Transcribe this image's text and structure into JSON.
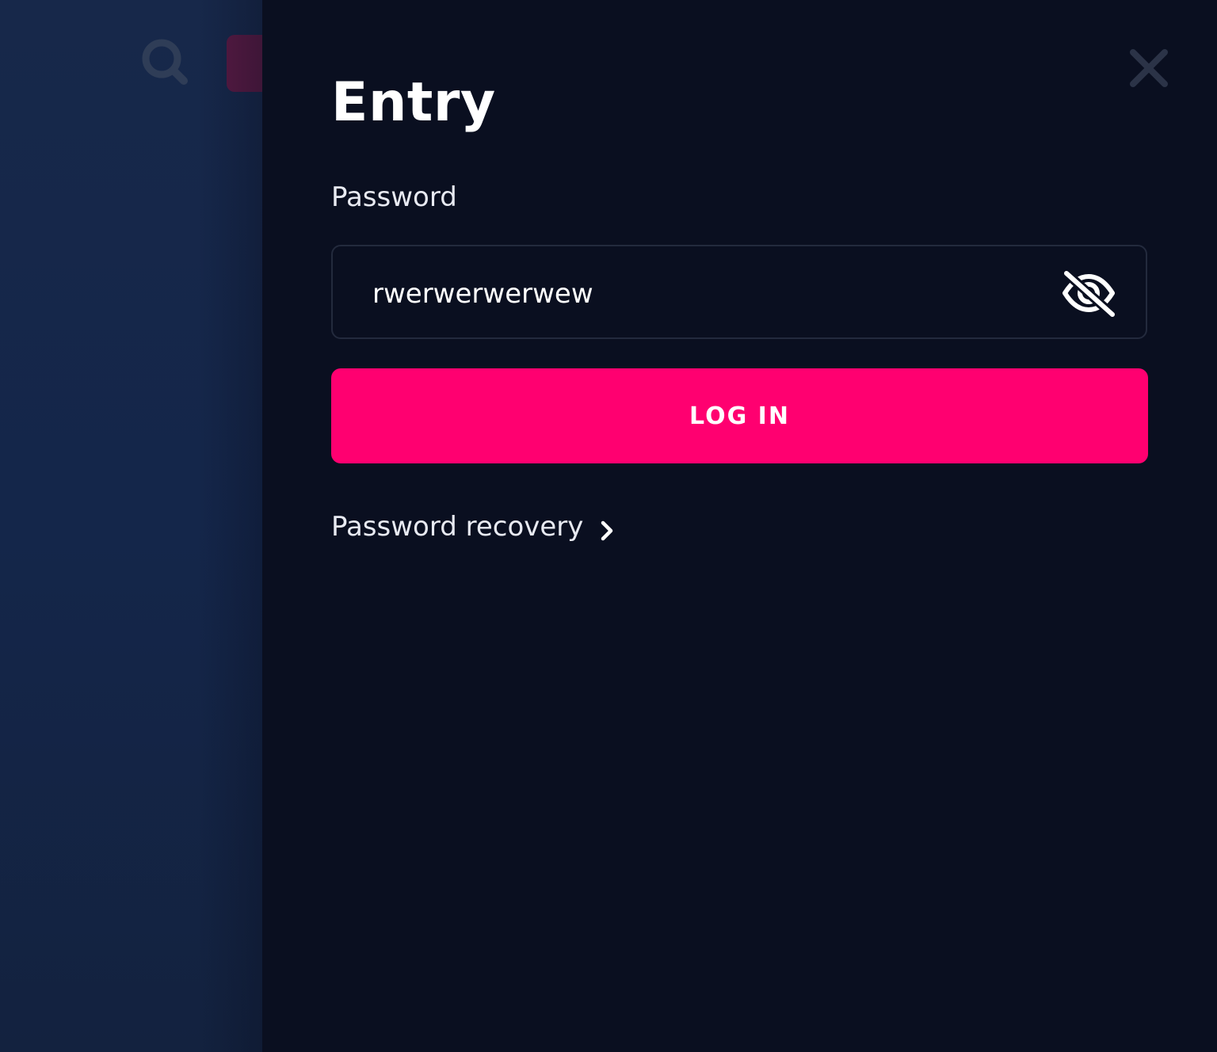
{
  "background": {
    "search_icon": "search-icon",
    "accent_tab_color": "#5a1a44"
  },
  "modal": {
    "title": "Entry",
    "close_icon": "close-icon",
    "password": {
      "label": "Password",
      "value": "rwerwerwerwew",
      "visibility_icon": "eye-off-icon"
    },
    "login_button": {
      "label": "LOG IN",
      "color": "#ff0070"
    },
    "recovery_link": {
      "label": "Password recovery",
      "icon": "chevron-right-icon"
    }
  }
}
